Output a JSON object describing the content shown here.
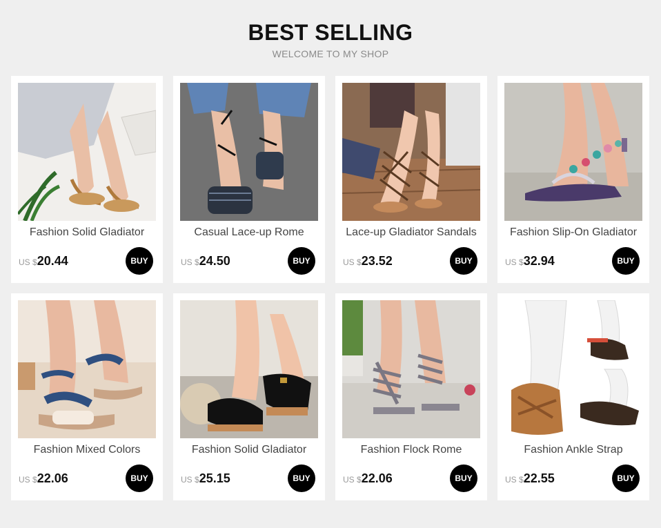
{
  "header": {
    "title": "BEST SELLING",
    "subtitle": "WELCOME TO MY SHOP"
  },
  "currency_prefix": "US $",
  "buy_label": "BUY",
  "products": [
    {
      "name": "Fashion Solid Gladiator",
      "price": "20.44",
      "image": "sandal-photo"
    },
    {
      "name": "Casual Lace-up Rome",
      "price": "24.50",
      "image": "sandal-photo"
    },
    {
      "name": "Lace-up Gladiator Sandals",
      "price": "23.52",
      "image": "sandal-photo"
    },
    {
      "name": "Fashion Slip-On Gladiator",
      "price": "32.94",
      "image": "sandal-photo"
    },
    {
      "name": "Fashion Mixed Colors",
      "price": "22.06",
      "image": "sandal-photo"
    },
    {
      "name": "Fashion Solid Gladiator",
      "price": "25.15",
      "image": "sandal-photo"
    },
    {
      "name": "Fashion Flock Rome",
      "price": "22.06",
      "image": "sandal-photo"
    },
    {
      "name": "Fashion Ankle Strap",
      "price": "22.55",
      "image": "sandal-photo"
    }
  ]
}
